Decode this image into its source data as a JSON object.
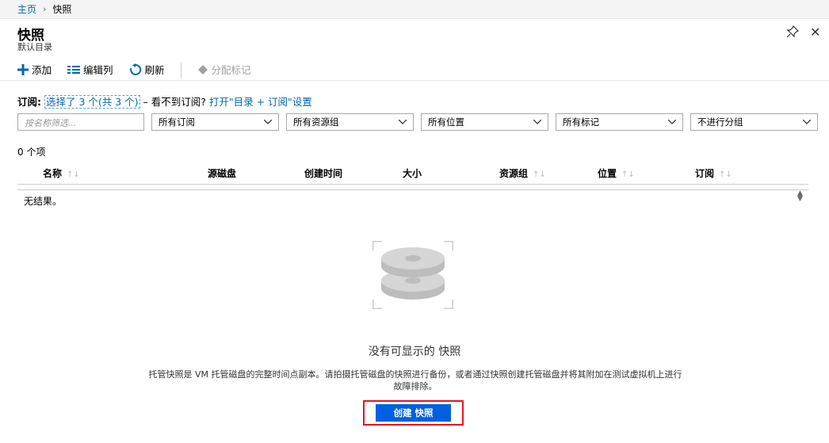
{
  "breadcrumb": {
    "home": "主页",
    "current": "快照"
  },
  "header": {
    "title": "快照",
    "subtitle": "默认目录"
  },
  "toolbar": {
    "add": "添加",
    "edit_columns": "编辑列",
    "refresh": "刷新",
    "assign_tags": "分配标记"
  },
  "subscription": {
    "label": "订阅:",
    "selected": "选择了 3 个(共 3 个)",
    "prompt": "– 看不到订阅?",
    "link": "打开\"目录 + 订阅\"设置"
  },
  "filters": {
    "name_placeholder": "按名称筛选...",
    "subscription": "所有订阅",
    "resource_group": "所有资源组",
    "location": "所有位置",
    "tags": "所有标记",
    "grouping": "不进行分组"
  },
  "count": "0 个项",
  "table": {
    "headers": [
      "名称",
      "源磁盘",
      "创建时间",
      "大小",
      "资源组",
      "位置",
      "订阅"
    ],
    "no_results": "无结果。"
  },
  "empty": {
    "title": "没有可显示的 快照",
    "description": "托管快照是 VM 托管磁盘的完整时间点副本。请拍摄托管磁盘的快照进行备份，或者通过快照创建托管磁盘并将其附加在测试虚拟机上进行故障排除。",
    "create_button": "创建 快照"
  }
}
